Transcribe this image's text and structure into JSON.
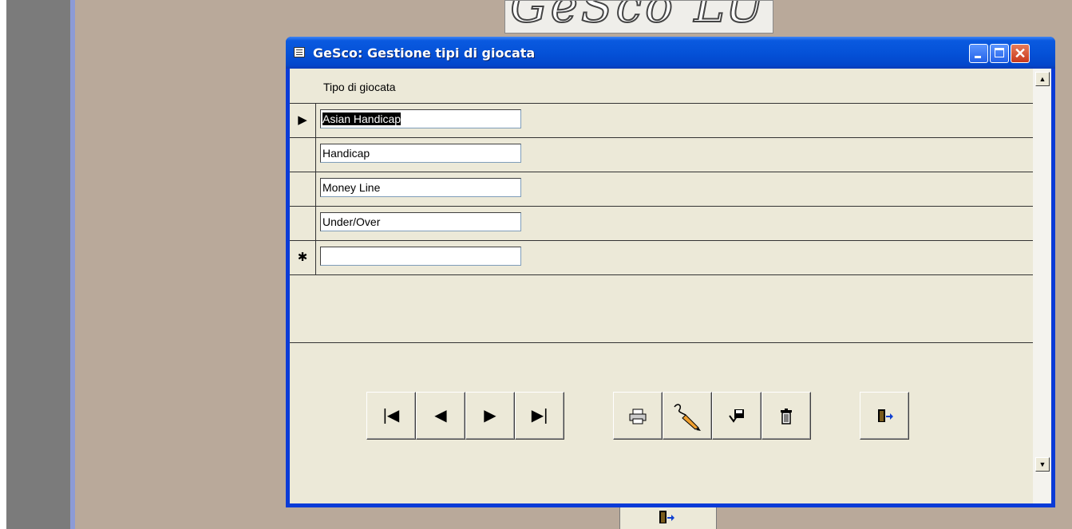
{
  "background": {
    "logo_text": "GeSco LU",
    "exit_icon": "exit-door-icon"
  },
  "window": {
    "title": "GeSco: Gestione tipi di giocata",
    "icon": "form-icon",
    "controls": {
      "close_symbol": "✕"
    }
  },
  "grid": {
    "column_header": "Tipo di giocata",
    "current_row_marker": "▶",
    "new_row_marker": "✱",
    "rows": [
      {
        "value": "Asian Handicap",
        "selected": true
      },
      {
        "value": "Handicap"
      },
      {
        "value": "Money Line"
      },
      {
        "value": "Under/Over"
      },
      {
        "value": ""
      }
    ]
  },
  "scrollbar": {
    "up_symbol": "▲",
    "down_symbol": "▼"
  },
  "toolbar": {
    "nav": [
      "|◀",
      "◀",
      "▶",
      "▶|"
    ],
    "actions": [
      "print-icon",
      "edit-pencil-icon",
      "save-icon",
      "trash-icon",
      "exit-icon"
    ]
  }
}
